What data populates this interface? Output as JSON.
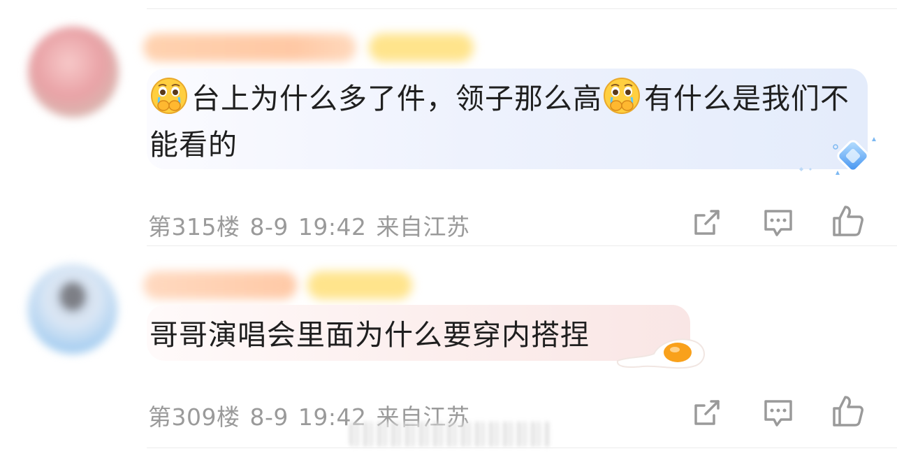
{
  "comments": [
    {
      "text_part1": "台上为什么多了件，领子那么高",
      "text_part2": "有什么是我们不能看的",
      "emoji_name": "crying-covering-mouth-emoji",
      "decoration": "blue-diamond",
      "bubble_colors": [
        "#fbfbff",
        "#e4ecfb"
      ],
      "floor": "第315楼",
      "date": "8-9",
      "time": "19:42",
      "location": "来自江苏"
    },
    {
      "text": "哥哥演唱会里面为什么要穿内搭捏",
      "decoration": "fried-egg",
      "bubble_colors": [
        "#fffafa",
        "#f9e6e5"
      ],
      "floor": "第309楼",
      "date": "8-9",
      "time": "19:42",
      "location": "来自江苏"
    }
  ],
  "actions": {
    "share_icon": "share-icon",
    "comment_icon": "comment-icon",
    "like_icon": "thumbs-up-icon",
    "icon_color": "#9a9a9a"
  },
  "colors": {
    "text": "#1f1f1f",
    "meta": "#9a9a9a",
    "divider": "#ececec",
    "vip_badge": "#ffe48c"
  }
}
